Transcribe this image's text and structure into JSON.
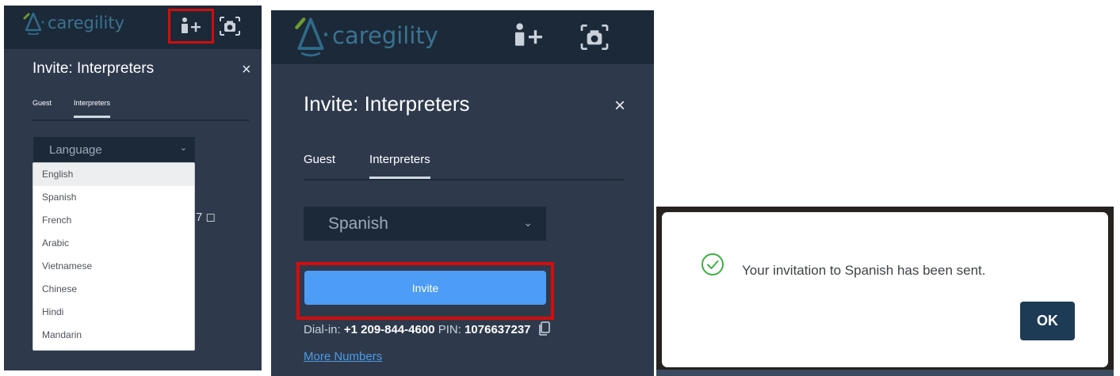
{
  "brand": {
    "name": "caregility"
  },
  "panel1": {
    "dialog": {
      "title": "Invite: Interpreters",
      "close_glyph": "×",
      "tabs": [
        "Guest",
        "Interpreters"
      ],
      "active_tab": "Interpreters"
    },
    "language_select": {
      "placeholder": "Language",
      "chevron": "⌄"
    },
    "language_options": [
      "English",
      "Spanish",
      "French",
      "Arabic",
      "Vietnamese",
      "Chinese",
      "Hindi",
      "Mandarin"
    ],
    "highlighted_option": "English",
    "partial_text": "7 ◻"
  },
  "panel2": {
    "dialog": {
      "title": "Invite: Interpreters",
      "close_glyph": "×",
      "tabs": [
        "Guest",
        "Interpreters"
      ],
      "active_tab": "Interpreters"
    },
    "language_select": {
      "value": "Spanish",
      "chevron": "⌄"
    },
    "invite_label": "Invite",
    "dialin": {
      "label": "Dial-in:",
      "number": "+1 209-844-4600",
      "pin_label": "PIN:",
      "pin": "1076637237"
    },
    "more_numbers": "More Numbers"
  },
  "confirmation": {
    "message": "Your invitation to Spanish has been sent.",
    "ok_label": "OK"
  },
  "icons": {
    "logo": "caregility-logo-icon",
    "add_user": "add-user-icon",
    "camera": "camera-snapshot-icon",
    "copy": "copy-icon",
    "success": "check-circle-icon"
  },
  "colors": {
    "panel_bg": "#2e3a4c",
    "header_bg": "#1c2938",
    "highlight_box": "#d10d0d",
    "invite_button": "#4d9cf5",
    "ok_button": "#1d3b55",
    "success_green": "#3cb043",
    "link": "#4e9be3"
  }
}
